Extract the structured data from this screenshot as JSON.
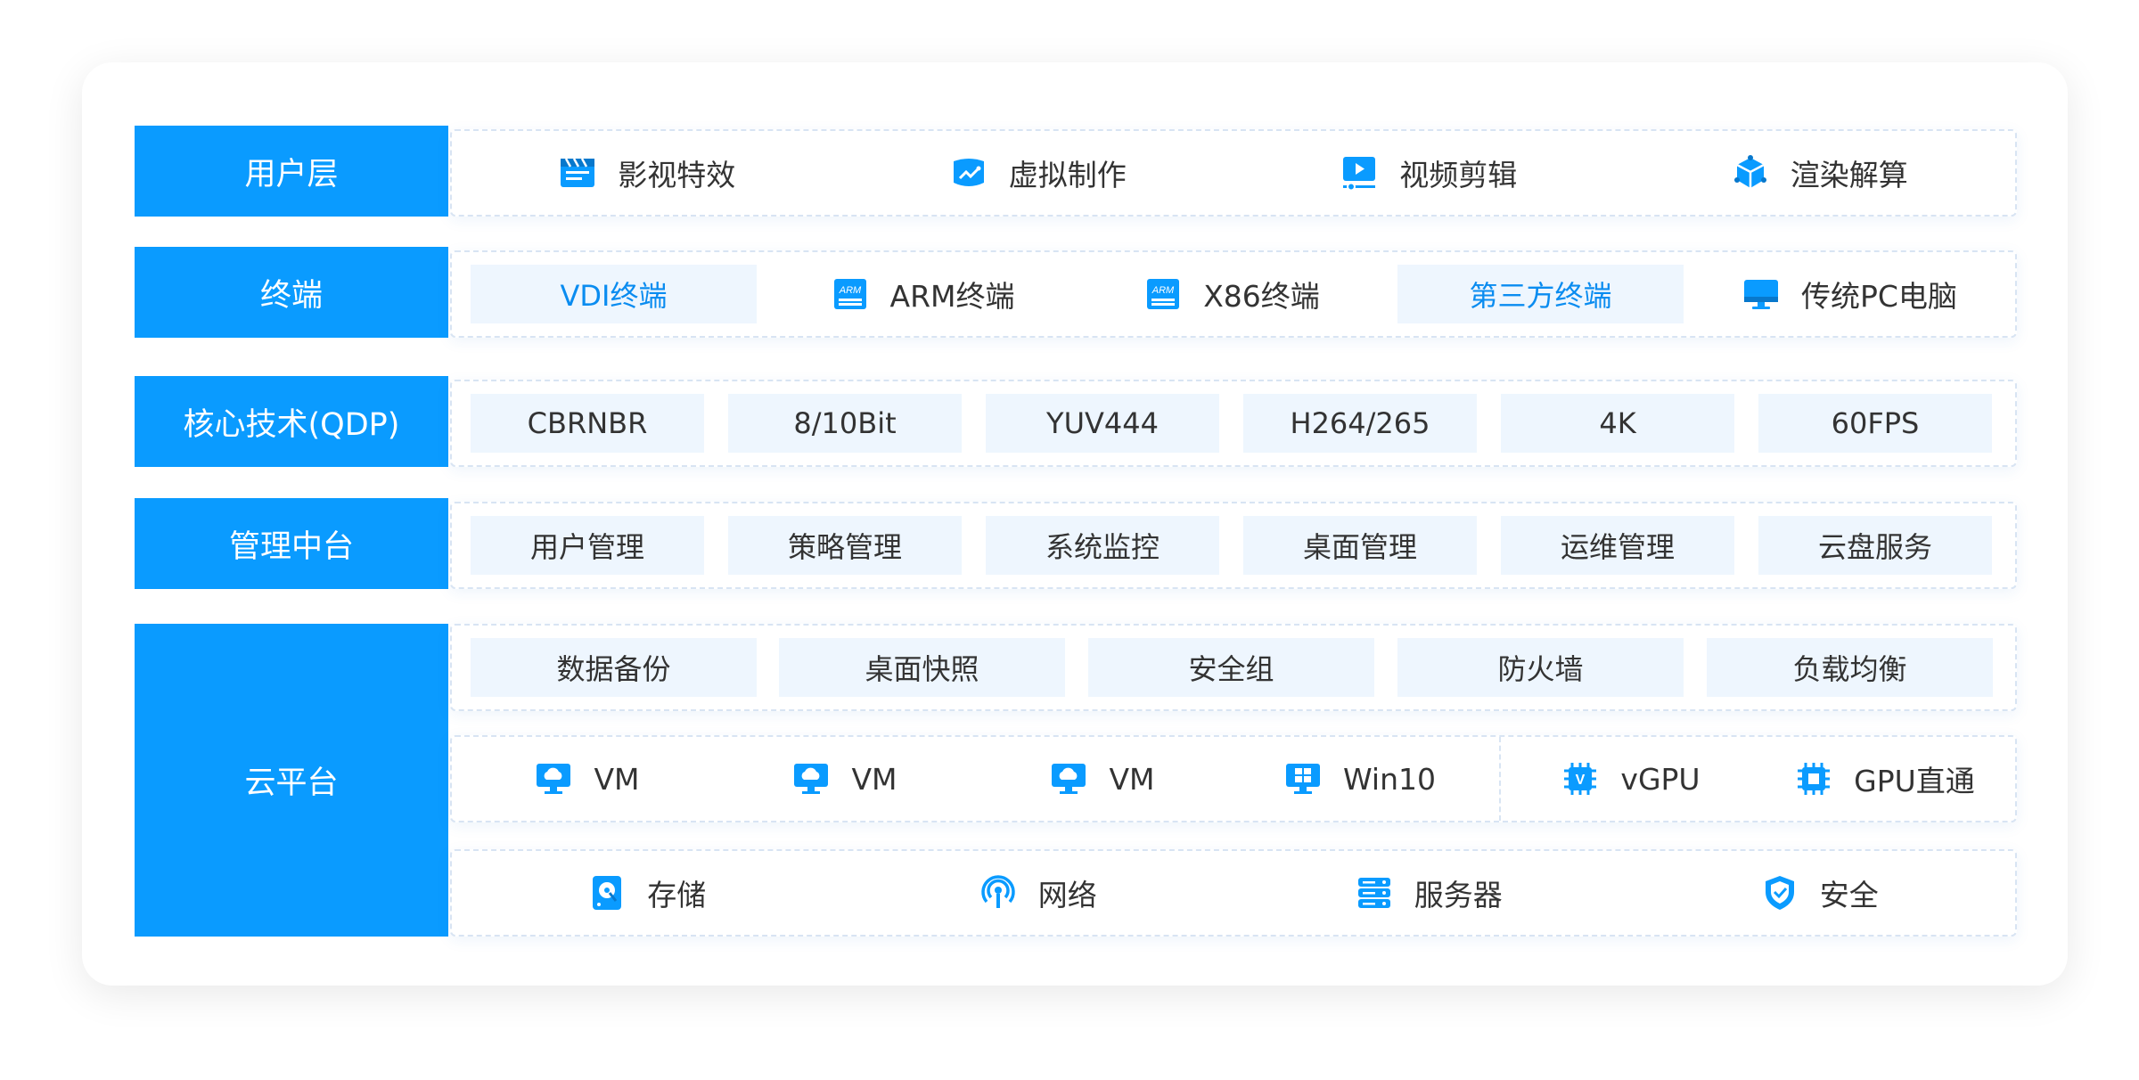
{
  "colors": {
    "accent": "#0a9bff",
    "tile_bg": "#eef6fe",
    "highlight_text": "#0a8cf0"
  },
  "rows": {
    "user": {
      "label": "用户层",
      "items": [
        {
          "icon": "clapperboard-icon",
          "text": "影视特效"
        },
        {
          "icon": "chart-box-icon",
          "text": "虚拟制作"
        },
        {
          "icon": "video-play-icon",
          "text": "视频剪辑"
        },
        {
          "icon": "cube-icon",
          "text": "渲染解算"
        }
      ]
    },
    "terminal": {
      "label": "终端",
      "items": [
        {
          "icon": "",
          "text": "VDI终端",
          "highlight": true
        },
        {
          "icon": "arm-chip-icon",
          "icon_text": "ARM",
          "text": "ARM终端"
        },
        {
          "icon": "arm-chip-icon",
          "icon_text": "ARM",
          "text": "X86终端"
        },
        {
          "icon": "",
          "text": "第三方终端",
          "highlight": true
        },
        {
          "icon": "monitor-icon",
          "text": "传统PC电脑"
        }
      ]
    },
    "core": {
      "label": "核心技术(QDP)",
      "items": [
        "CBRNBR",
        "8/10Bit",
        "YUV444",
        "H264/265",
        "4K",
        "60FPS"
      ]
    },
    "mgmt": {
      "label": "管理中台",
      "items": [
        "用户管理",
        "策略管理",
        "系统监控",
        "桌面管理",
        "运维管理",
        "云盘服务"
      ]
    },
    "cloud": {
      "label": "云平台",
      "services": [
        "数据备份",
        "桌面快照",
        "安全组",
        "防火墙",
        "负载均衡"
      ],
      "vms": [
        {
          "icon": "cloud-monitor-icon",
          "text": "VM"
        },
        {
          "icon": "cloud-monitor-icon",
          "text": "VM"
        },
        {
          "icon": "cloud-monitor-icon",
          "text": "VM"
        },
        {
          "icon": "windows-icon",
          "text": "Win10"
        }
      ],
      "gpus": [
        {
          "icon": "gpu-chip-icon",
          "icon_text": "V",
          "text": "vGPU"
        },
        {
          "icon": "chip-icon",
          "text": "GPU直通"
        }
      ],
      "infra": [
        {
          "icon": "storage-icon",
          "text": "存储"
        },
        {
          "icon": "network-icon",
          "text": "网络"
        },
        {
          "icon": "server-icon",
          "text": "服务器"
        },
        {
          "icon": "shield-icon",
          "text": "安全"
        }
      ]
    }
  }
}
